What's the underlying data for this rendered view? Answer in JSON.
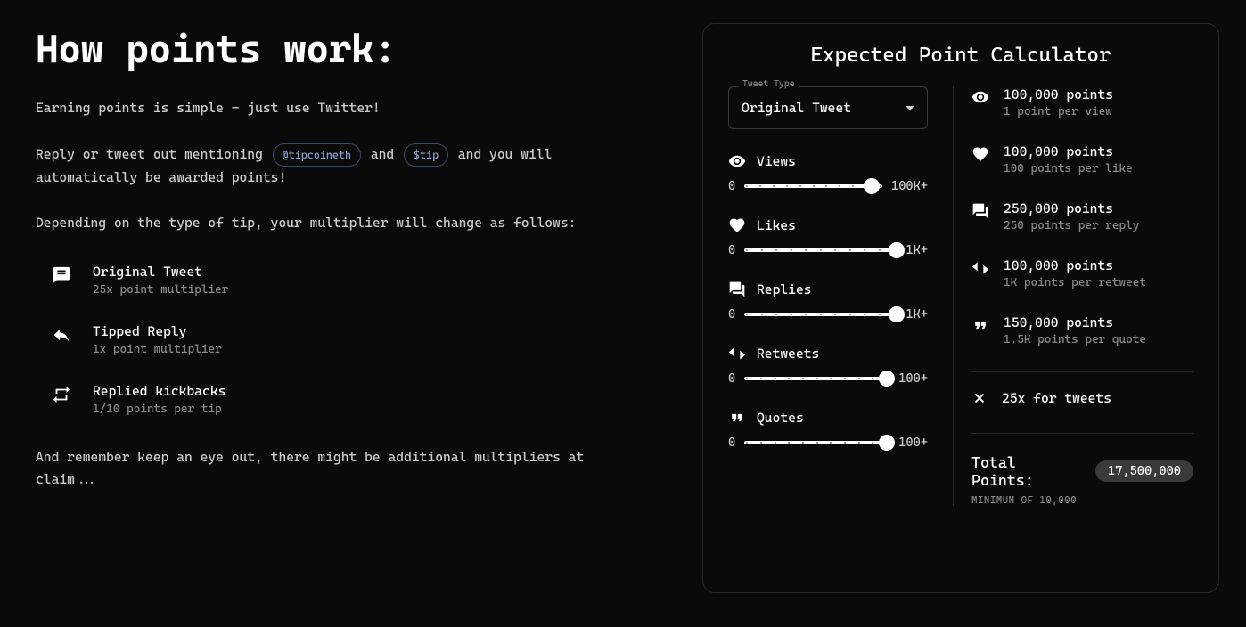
{
  "left": {
    "title": "How points work:",
    "intro": "Earning points is simple - just use Twitter!",
    "line2_a": "Reply or tweet out mentioning ",
    "pill1": "@tipcoineth",
    "line2_b": " and ",
    "pill2": "$tip",
    "line2_c": " and you will automatically be awarded points!",
    "line3": "Depending on the type of tip, your multiplier will change as follows:",
    "multipliers": [
      {
        "title": "Original Tweet",
        "sub": "25x point multiplier"
      },
      {
        "title": "Tipped Reply",
        "sub": "1x point multiplier"
      },
      {
        "title": "Replied kickbacks",
        "sub": "1/10 points per tip"
      }
    ],
    "outro": "And remember keep an eye out, there might be additional multipliers at claim..."
  },
  "calc": {
    "title": "Expected Point Calculator",
    "select_legend": "Tweet Type",
    "select_value": "Original Tweet",
    "sliders": [
      {
        "label": "Views",
        "min": "0",
        "max": "100K+",
        "thumb_pct": 92
      },
      {
        "label": "Likes",
        "min": "0",
        "max": "1K+",
        "thumb_pct": 100
      },
      {
        "label": "Replies",
        "min": "0",
        "max": "1K+",
        "thumb_pct": 100
      },
      {
        "label": "Retweets",
        "min": "0",
        "max": "100+",
        "thumb_pct": 98
      },
      {
        "label": "Quotes",
        "min": "0",
        "max": "100+",
        "thumb_pct": 98
      }
    ],
    "results": [
      {
        "main": "100,000 points",
        "sub": "1 point per view"
      },
      {
        "main": "100,000 points",
        "sub": "100 points per like"
      },
      {
        "main": "250,000 points",
        "sub": "250 points per reply"
      },
      {
        "main": "100,000 points",
        "sub": "1K points per retweet"
      },
      {
        "main": "150,000 points",
        "sub": "1.5K points per quote"
      }
    ],
    "multiplier": "25x for tweets",
    "total_label": "Total Points:",
    "total_value": "17,500,000",
    "total_min": "MINIMUM OF 10,000"
  }
}
